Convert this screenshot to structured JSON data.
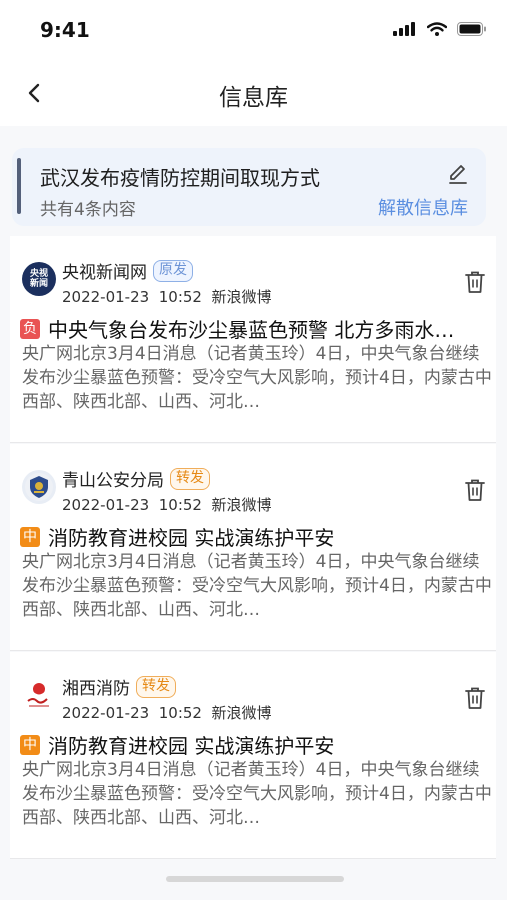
{
  "status_bar": {
    "time": "9:41"
  },
  "nav": {
    "title": "信息库"
  },
  "library": {
    "title": "武汉发布疫情防控期间取现方式",
    "count_text": "共有4条内容",
    "dissolve_label": "解散信息库"
  },
  "posts": [
    {
      "source": "央视新闻网",
      "tag": "原发",
      "date": "2022-01-23",
      "time": "10:52",
      "platform": "新浪微博",
      "badge": "负",
      "headline": "中央气象台发布沙尘暴蓝色预警 北方多雨水…",
      "summary": "央广网北京3月4日消息（记者黄玉玲）4日，中央气象台继续发布沙尘暴蓝色预警：受冷空气大风影响，预计4日，内蒙古中西部、陕西北部、山西、河北…",
      "avatar_text": "央视新闻"
    },
    {
      "source": "青山公安分局",
      "tag": "转发",
      "date": "2022-01-23",
      "time": "10:52",
      "platform": "新浪微博",
      "badge": "中",
      "headline": "消防教育进校园 实战演练护平安",
      "summary": "央广网北京3月4日消息（记者黄玉玲）4日，中央气象台继续发布沙尘暴蓝色预警：受冷空气大风影响，预计4日，内蒙古中西部、陕西北部、山西、河北…"
    },
    {
      "source": "湘西消防",
      "tag": "转发",
      "date": "2022-01-23",
      "time": "10:52",
      "platform": "新浪微博",
      "badge": "中",
      "headline": "消防教育进校园 实战演练护平安",
      "summary": "央广网北京3月4日消息（记者黄玉玲）4日，中央气象台继续发布沙尘暴蓝色预警：受冷空气大风影响，预计4日，内蒙古中西部、陕西北部、山西、河北…"
    }
  ],
  "colors": {
    "accent": "#5a8ee0",
    "negative_badge": "#e95454",
    "neutral_badge": "#f28c17",
    "forward_tag": "#e68a16"
  }
}
